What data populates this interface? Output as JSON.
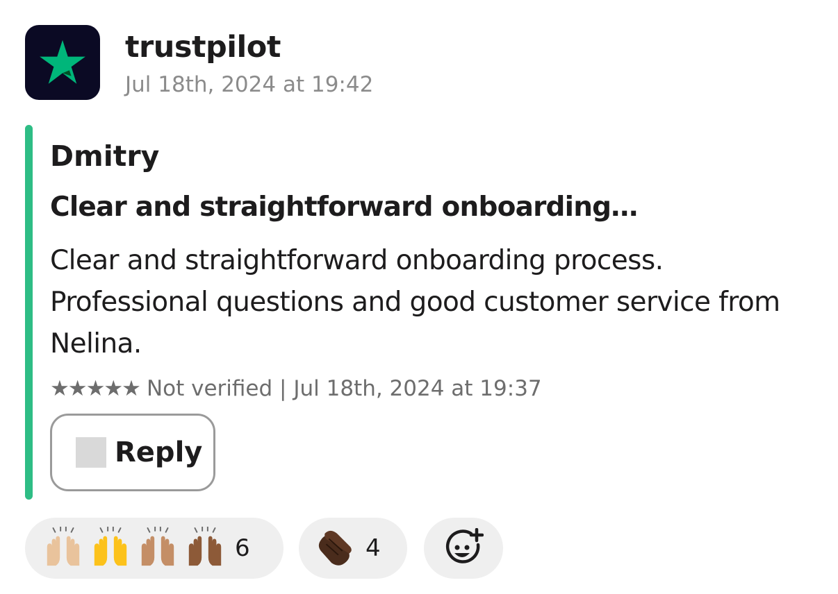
{
  "message": {
    "sender": "trustpilot",
    "timestamp": "Jul 18th, 2024 at 19:42"
  },
  "colors": {
    "avatar_bg": "#0b0a24",
    "trustpilot_green": "#00b67a",
    "attachment_bar": "#2ebd85",
    "reaction_bg": "#efefef"
  },
  "review": {
    "author": "Dmitry",
    "title": "Clear and straightforward onboarding…",
    "body": "Clear and straightforward onboarding process. Professional questions and good customer service from Nelina.",
    "rating": 5,
    "stars": "★★★★★",
    "meta": "Not verified | Jul 18th, 2024 at 19:37"
  },
  "actions": {
    "reply_label": "Reply",
    "reply_icon": "reply-icon"
  },
  "reactions": [
    {
      "emoji": [
        "raising-hands-light",
        "raising-hands-yellow",
        "raising-hands-medium",
        "raising-hands-dark"
      ],
      "count": "6"
    },
    {
      "emoji": [
        "clapping-hands-dark"
      ],
      "count": "4"
    }
  ],
  "add_reaction_icon": "add-reaction-icon"
}
